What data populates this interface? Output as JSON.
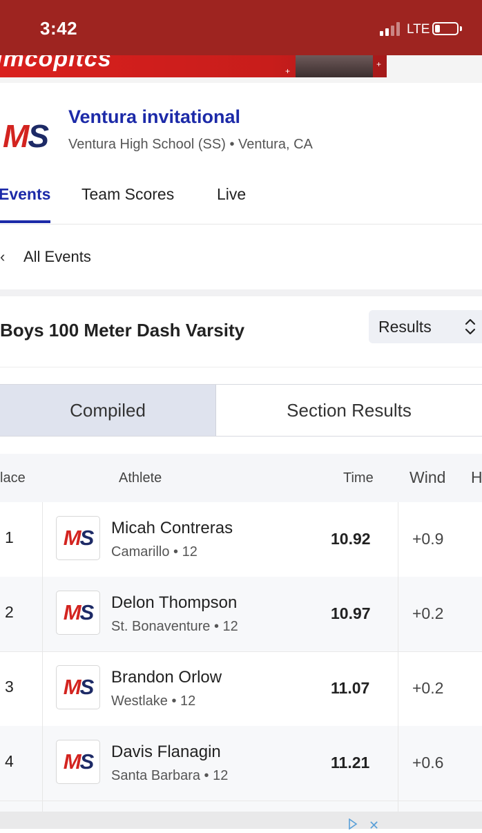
{
  "status_bar": {
    "time": "3:42",
    "network": "LTE"
  },
  "banner": {
    "ad_text": "ımcopıtcs"
  },
  "meet": {
    "title": "Ventura invitational",
    "subtitle": "Ventura High School (SS) • Ventura, CA",
    "logo_text_m": "M",
    "logo_text_s": "S"
  },
  "tabs": [
    {
      "label": "Events",
      "active": true
    },
    {
      "label": "Team Scores",
      "active": false
    },
    {
      "label": "Live",
      "active": false
    }
  ],
  "back": {
    "chevron": "‹",
    "label": "All Events"
  },
  "event": {
    "title": "Boys 100 Meter Dash Varsity",
    "view_select": "Results"
  },
  "segments": {
    "left": "Compiled",
    "right": "Section Results"
  },
  "table": {
    "headers": {
      "place": "lace",
      "athlete": "Athlete",
      "time": "Time",
      "wind": "Wind",
      "extra": "H"
    },
    "rows": [
      {
        "place": "1",
        "name": "Micah Contreras",
        "school": "Camarillo • 12",
        "time": "10.92",
        "wind": "+0.9"
      },
      {
        "place": "2",
        "name": "Delon Thompson",
        "school": "St. Bonaventure • 12",
        "time": "10.97",
        "wind": "+0.2"
      },
      {
        "place": "3",
        "name": "Brandon Orlow",
        "school": "Westlake • 12",
        "time": "11.07",
        "wind": "+0.2"
      },
      {
        "place": "4",
        "name": "Davis Flanagin",
        "school": "Santa Barbara • 12",
        "time": "11.21",
        "wind": "+0.6"
      }
    ]
  },
  "colors": {
    "status_bar": "#9e2420",
    "brand_blue": "#1c2aa8",
    "brand_red": "#d32420",
    "brand_navy": "#1d2a66"
  },
  "icons": {
    "signal": "signal-bars-icon",
    "battery": "battery-icon",
    "back": "chevron-left-icon",
    "select": "chevron-updown-icon",
    "ad_close": "close-icon",
    "ad_choices": "ad-choices-icon"
  }
}
